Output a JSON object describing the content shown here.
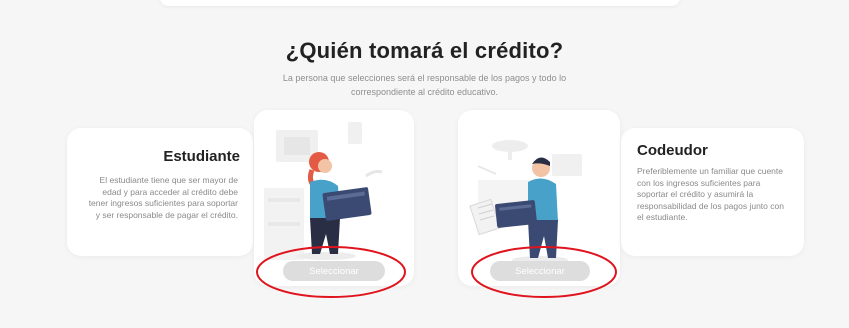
{
  "heading": {
    "title": "¿Quién tomará el crédito?",
    "subtitle": "La persona que selecciones será el responsable de los pagos y todo lo correspondiente al crédito educativo."
  },
  "options": {
    "student": {
      "name": "Estudiante",
      "description": "El estudiante tiene que ser mayor de edad y para acceder al crédito debe tener ingresos suficientes para soportar y ser responsable de pagar el crédito.",
      "button_label": "Seleccionar"
    },
    "cosigner": {
      "name": "Codeudor",
      "description": "Preferiblemente un familiar que cuente con los ingresos suficientes para soportar el crédito y asumirá la responsabilidad de los pagos junto con el estudiante.",
      "button_label": "Seleccionar"
    }
  },
  "colors": {
    "background": "#f6f6f6",
    "card": "#ffffff",
    "button_bg": "#dddddd",
    "annotation": "#e0141e"
  },
  "illustrations": {
    "student": "woman-with-folder-illustration",
    "cosigner": "man-with-folder-illustration"
  }
}
